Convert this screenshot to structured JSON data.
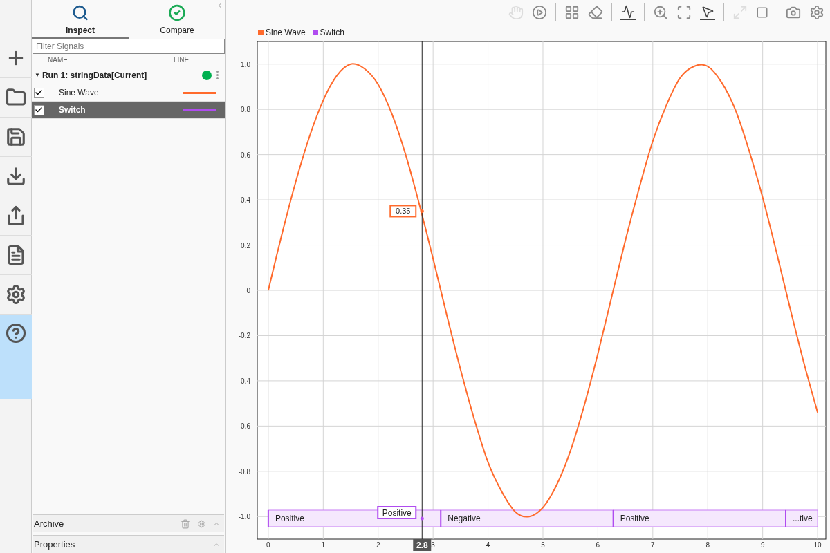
{
  "rail": {
    "items": [
      {
        "selected": false
      },
      {
        "selected": false
      },
      {
        "selected": false
      },
      {
        "selected": false
      },
      {
        "selected": false
      },
      {
        "selected": false
      },
      {
        "selected": false
      },
      {
        "selected": true
      }
    ]
  },
  "tabs": [
    {
      "label": "Inspect",
      "selected": true
    },
    {
      "label": "Compare",
      "selected": false
    }
  ],
  "filter": {
    "placeholder": "Filter Signals"
  },
  "table": {
    "columns": [
      "NAME",
      "LINE"
    ],
    "run": {
      "toggle": "▼",
      "label": "Run 1: stringData[Current]",
      "expanded": true,
      "color": "#00b050"
    },
    "rows": [
      {
        "name": "Sine Wave",
        "checked": true,
        "selected": false,
        "color": "#ff6a2c"
      },
      {
        "name": "Switch",
        "checked": true,
        "selected": true,
        "color": "#b04cf0"
      }
    ]
  },
  "sections": [
    {
      "label": "Archive",
      "kind": "archive"
    },
    {
      "label": "Properties",
      "kind": "plain"
    }
  ],
  "state_signals": [
    {
      "name": "Switch",
      "color": "#b04cf0",
      "segments": [
        {
          "label": "Positive"
        },
        {
          "label": "Negative"
        },
        {
          "label": "Positive"
        },
        {
          "label": "...tive"
        }
      ]
    }
  ],
  "chart_data": {
    "type": "line",
    "grid": true,
    "xlim": [
      -0.2,
      10.15
    ],
    "ylim": [
      -1.1,
      1.1
    ],
    "xticks": [
      0,
      1,
      2,
      3,
      4,
      5,
      6,
      7,
      8,
      9,
      10
    ],
    "yticks": [
      {
        "value": 1,
        "label": "1.0"
      },
      {
        "value": 0.8,
        "label": "0.8"
      },
      {
        "value": 0.6,
        "label": "0.6"
      },
      {
        "value": 0.4,
        "label": "0.4"
      },
      {
        "value": 0.2,
        "label": "0.2"
      },
      {
        "value": 0,
        "label": "0"
      },
      {
        "value": -0.2,
        "label": "-0.2"
      },
      {
        "value": -0.4,
        "label": "-0.4"
      },
      {
        "value": -0.6,
        "label": "-0.6"
      },
      {
        "value": -0.8,
        "label": "-0.8"
      },
      {
        "value": -1,
        "label": "-1.0"
      }
    ],
    "x": [
      0,
      0.25,
      0.5,
      0.75,
      1,
      1.25,
      1.5,
      1.75,
      2,
      2.25,
      2.5,
      2.75,
      3,
      3.25,
      3.5,
      3.75,
      4,
      4.25,
      4.5,
      4.75,
      5,
      5.25,
      5.5,
      5.75,
      6,
      6.25,
      6.5,
      6.75,
      7,
      7.25,
      7.5,
      7.75,
      8,
      8.25,
      8.5,
      8.75,
      9,
      9.25,
      9.5,
      9.75,
      10
    ],
    "series": [
      {
        "name": "Sine Wave",
        "color": "#ff6a2c",
        "values": [
          0,
          0.25,
          0.48,
          0.68,
          0.84,
          0.95,
          1.0,
          0.98,
          0.91,
          0.78,
          0.6,
          0.38,
          0.14,
          -0.11,
          -0.35,
          -0.57,
          -0.76,
          -0.89,
          -0.98,
          -1.0,
          -0.96,
          -0.86,
          -0.71,
          -0.51,
          -0.28,
          -0.03,
          0.22,
          0.45,
          0.66,
          0.82,
          0.94,
          0.99,
          0.99,
          0.92,
          0.8,
          0.62,
          0.41,
          0.17,
          -0.08,
          -0.32,
          -0.54
        ]
      }
    ],
    "annotations": [
      {
        "x": 2.8,
        "text": "2.8"
      },
      {
        "x": 2.8,
        "y": 0.35,
        "text": "0.35"
      },
      {
        "text": "Positive"
      }
    ]
  }
}
